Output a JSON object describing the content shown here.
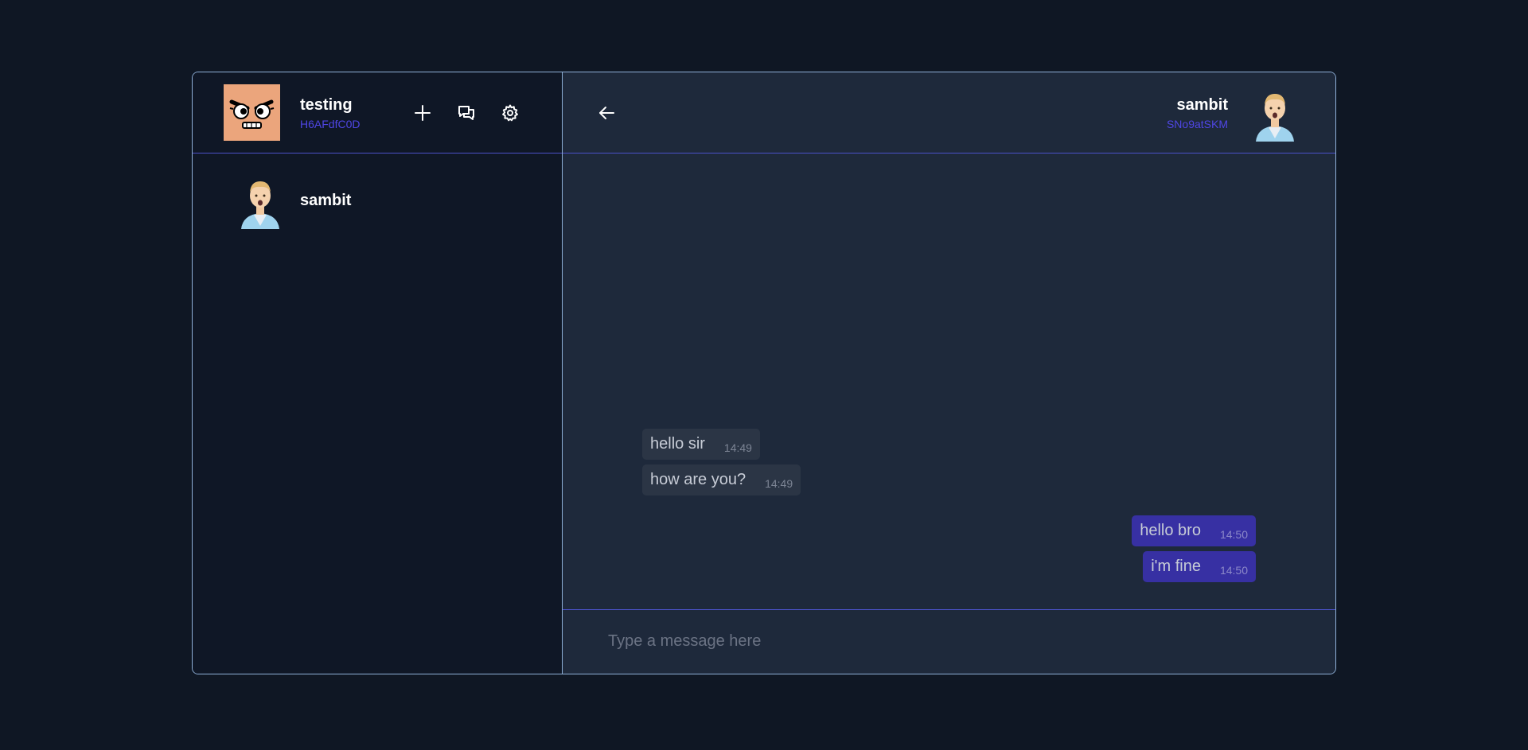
{
  "me": {
    "name": "testing",
    "id": "H6AFdfC0D",
    "avatar_icon": "angry-face-avatar-icon"
  },
  "header_actions": [
    {
      "icon": "plus-icon",
      "name": "new-chat-button"
    },
    {
      "icon": "chat-bubbles-icon",
      "name": "chats-button"
    },
    {
      "icon": "gear-icon",
      "name": "settings-button"
    }
  ],
  "contacts": [
    {
      "name": "sambit",
      "avatar_icon": "man-avatar-icon"
    }
  ],
  "peer": {
    "name": "sambit",
    "id": "SNo9atSKM",
    "avatar_icon": "man-avatar-icon"
  },
  "messages": [
    {
      "direction": "in",
      "text": "hello sir",
      "time": "14:49"
    },
    {
      "direction": "in",
      "text": "how are you?",
      "time": "14:49"
    },
    {
      "direction": "out",
      "text": "hello bro",
      "time": "14:50"
    },
    {
      "direction": "out",
      "text": "i'm fine",
      "time": "14:50"
    }
  ],
  "composer": {
    "placeholder": "Type a message here"
  },
  "colors": {
    "background": "#0f1724",
    "sidebar": "#0f1726",
    "chat": "#1e293b",
    "accent": "#4f46e5",
    "outgoing_bubble": "#3730a3",
    "incoming_bubble": "#2b3545"
  }
}
